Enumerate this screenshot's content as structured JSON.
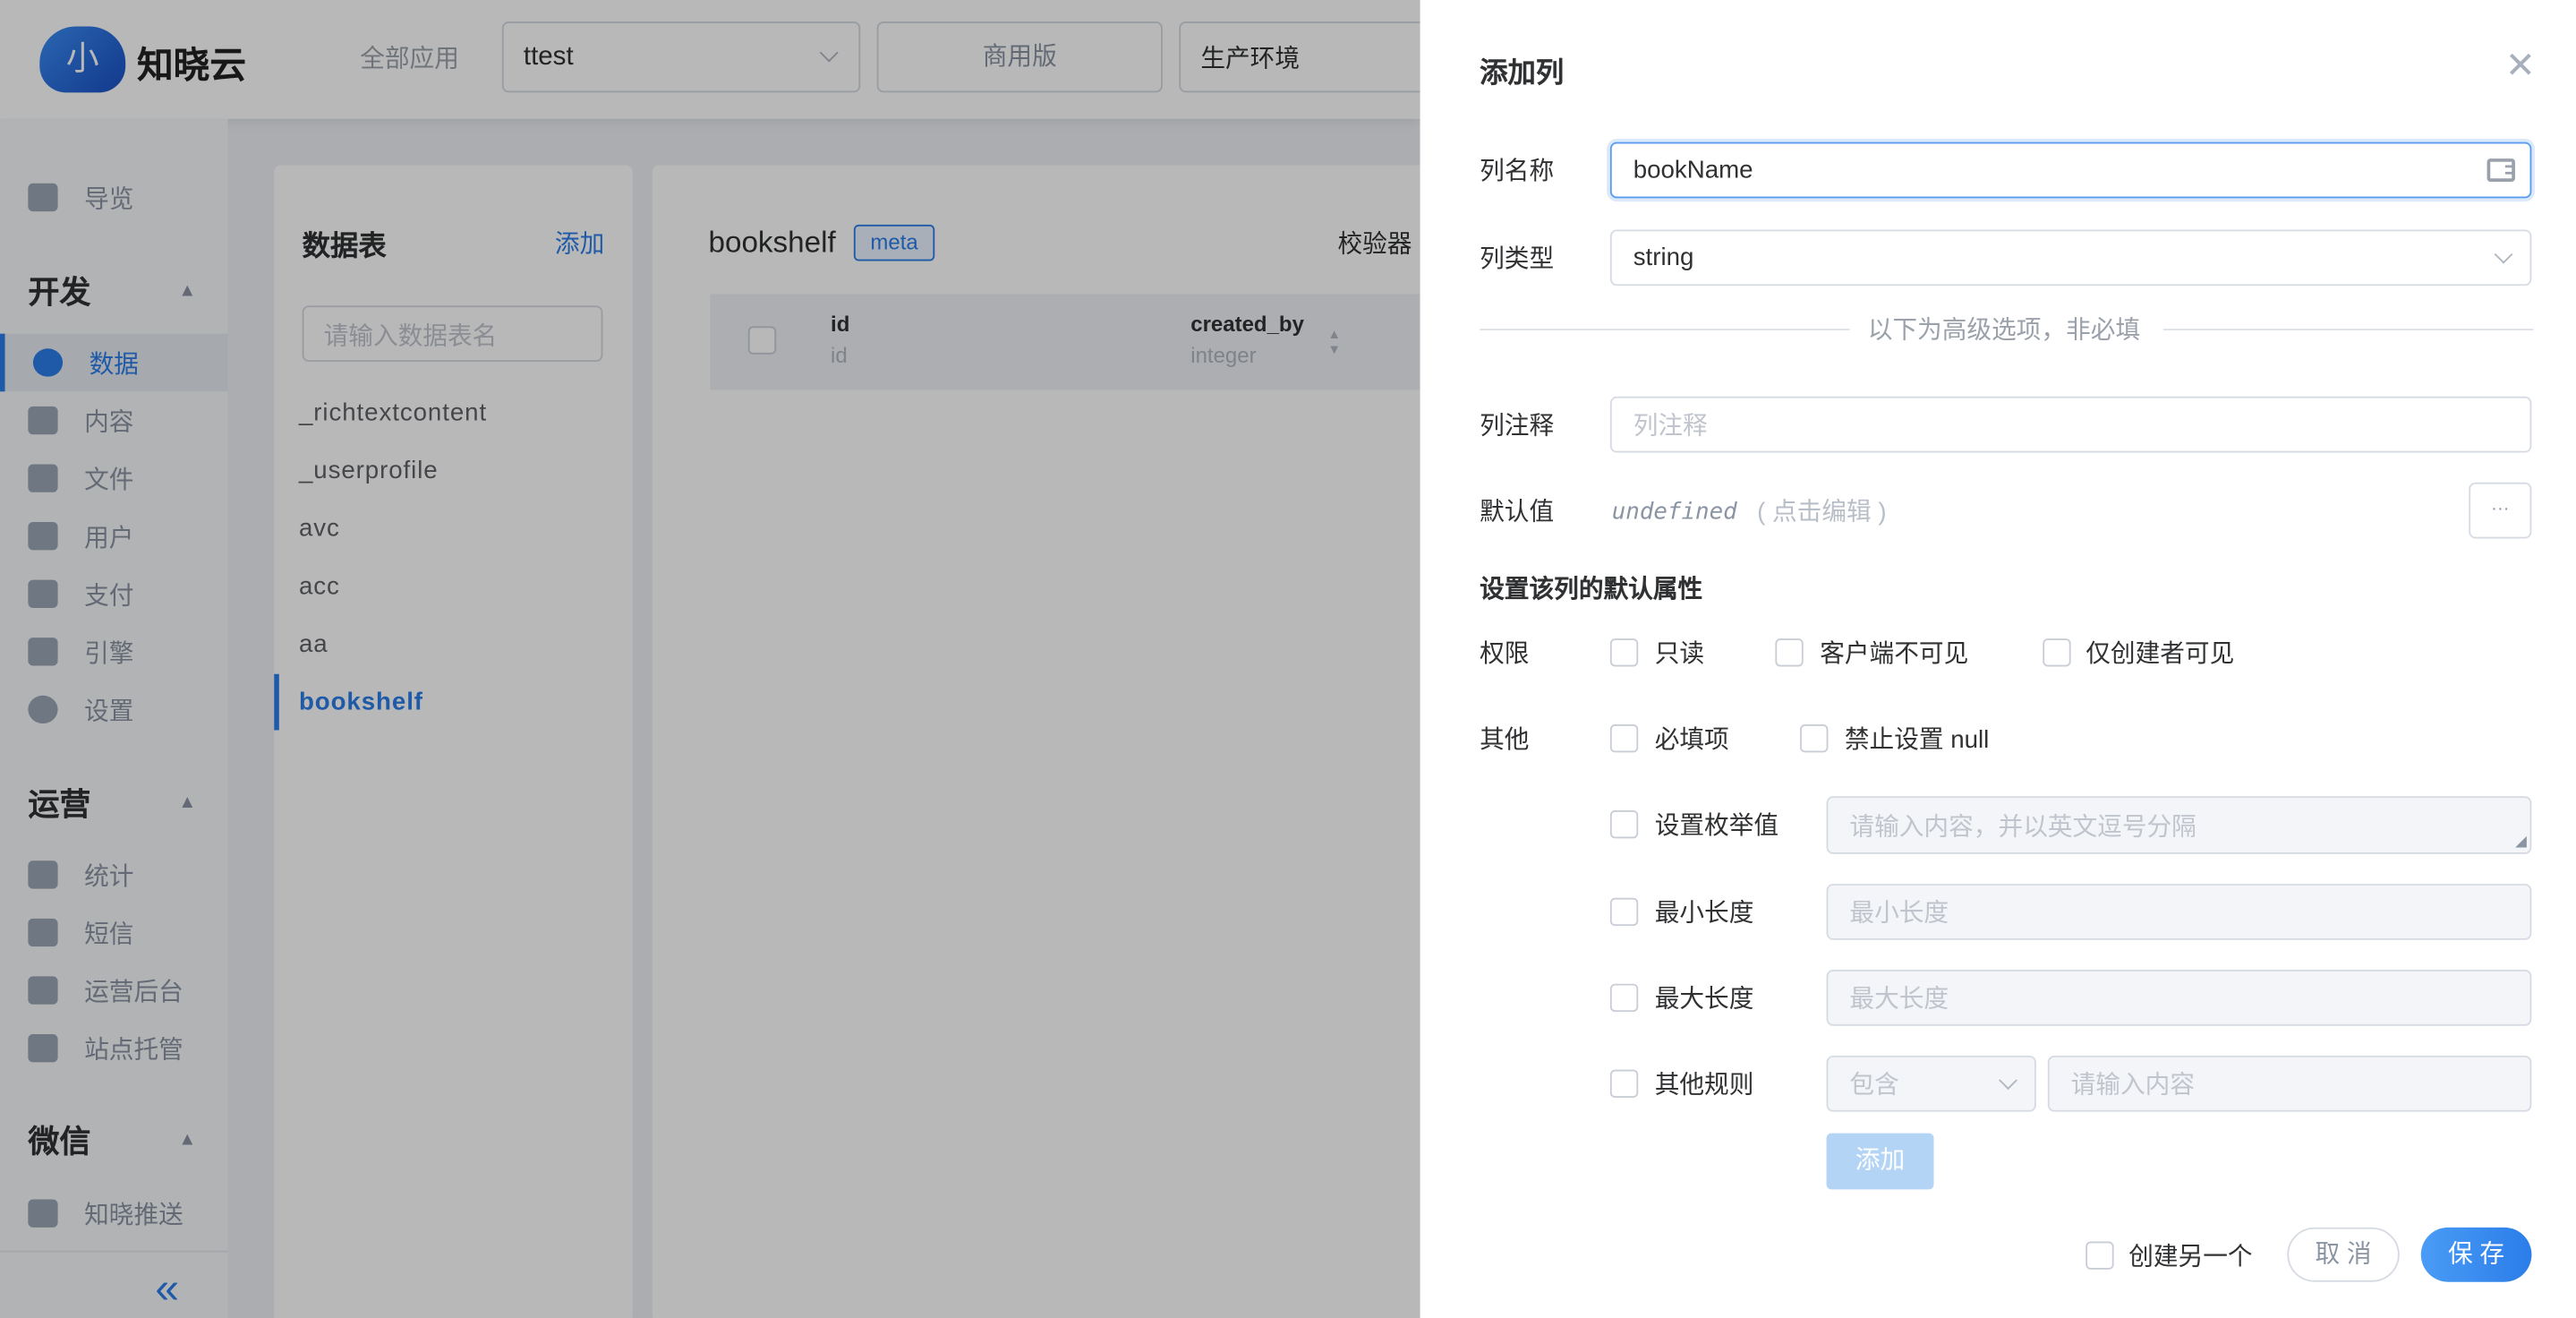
{
  "header": {
    "brand": "知晓云",
    "all_apps": "全部应用",
    "app_select": "ttest",
    "plan": "商用版",
    "env": "生产环境"
  },
  "sidebar": {
    "overview": "导览",
    "groups": [
      {
        "title": "开发",
        "items": [
          "数据",
          "内容",
          "文件",
          "用户",
          "支付",
          "引擎",
          "设置"
        ]
      },
      {
        "title": "运营",
        "items": [
          "统计",
          "短信",
          "运营后台",
          "站点托管"
        ]
      },
      {
        "title": "微信",
        "items": [
          "知晓推送"
        ]
      }
    ],
    "active": "数据",
    "collapse_icon": "double-chevron-left"
  },
  "tables_card": {
    "title": "数据表",
    "add": "添加",
    "search_placeholder": "请输入数据表名",
    "items": [
      "_richtextcontent",
      "_userprofile",
      "avc",
      "acc",
      "aa",
      "bookshelf"
    ],
    "active": "bookshelf"
  },
  "table_card": {
    "title": "bookshelf",
    "badge": "meta",
    "validator": "校验器",
    "columns": [
      {
        "name": "id",
        "type": "id"
      },
      {
        "name": "created_by",
        "type": "integer"
      }
    ]
  },
  "dialog": {
    "title": "添加列",
    "name_label": "列名称",
    "name_value": "bookName",
    "type_label": "列类型",
    "type_value": "string",
    "divider": "以下为高级选项，非必填",
    "comment_label": "列注释",
    "comment_placeholder": "列注释",
    "default_label": "默认值",
    "default_value": "undefined",
    "default_hint": "( 点击编辑 )",
    "more": "···",
    "attr_title": "设置该列的默认属性",
    "perm_label": "权限",
    "perm": [
      "只读",
      "客户端不可见",
      "仅创建者可见"
    ],
    "other_label": "其他",
    "other": [
      "必填项",
      "禁止设置 null"
    ],
    "enum": {
      "label": "设置枚举值",
      "placeholder": "请输入内容，并以英文逗号分隔"
    },
    "min": {
      "label": "最小长度",
      "placeholder": "最小长度"
    },
    "max": {
      "label": "最大长度",
      "placeholder": "最大长度"
    },
    "rule": {
      "label": "其他规则",
      "select": "包含",
      "placeholder": "请输入内容"
    },
    "add_button": "添加",
    "create_another": "创建另一个",
    "cancel": "取 消",
    "save": "保 存"
  },
  "colors": {
    "primary": "#2b7de9",
    "overlay": "rgba(0,0,0,0.28)"
  }
}
